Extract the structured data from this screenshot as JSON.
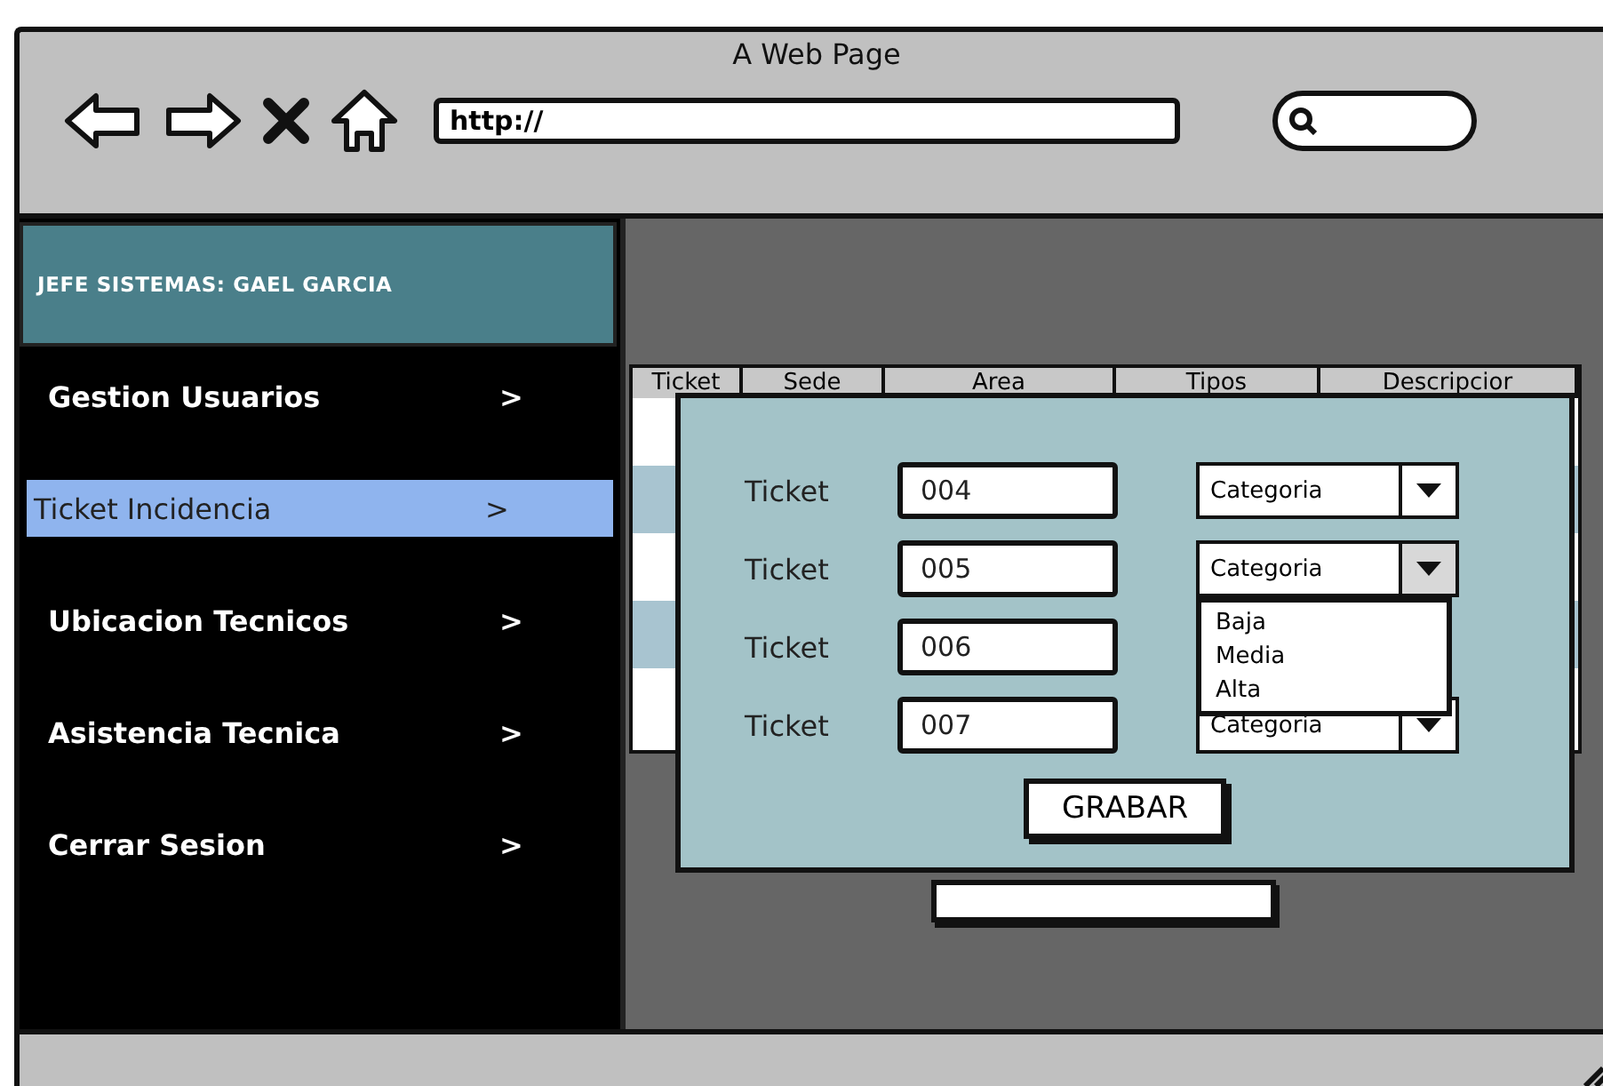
{
  "window": {
    "title": "A Web Page"
  },
  "address_bar": {
    "value": "http://"
  },
  "sidebar": {
    "header": "JEFE SISTEMAS: GAEL GARCIA",
    "items": [
      {
        "label": "Gestion Usuarios",
        "arrow": ">",
        "selected": false
      },
      {
        "label": "Ticket Incidencia",
        "arrow": ">",
        "selected": true
      },
      {
        "label": "Ubicacion Tecnicos",
        "arrow": ">",
        "selected": false
      },
      {
        "label": "Asistencia Tecnica",
        "arrow": ">",
        "selected": false
      },
      {
        "label": "Cerrar Sesion",
        "arrow": ">",
        "selected": false
      }
    ]
  },
  "table": {
    "columns": [
      "Ticket",
      "Sede",
      "Area",
      "Tipos",
      "Descripcior"
    ]
  },
  "dialog": {
    "rows": [
      {
        "label": "Ticket",
        "value": "004",
        "combo": "Categoria",
        "expanded": false
      },
      {
        "label": "Ticket",
        "value": "005",
        "combo": "Categoria",
        "expanded": true,
        "options": [
          "Baja",
          "Media",
          "Alta"
        ]
      },
      {
        "label": "Ticket",
        "value": "006"
      },
      {
        "label": "Ticket",
        "value": "007",
        "combo": "Categoria",
        "expanded": false
      }
    ],
    "button": "GRABAR"
  }
}
